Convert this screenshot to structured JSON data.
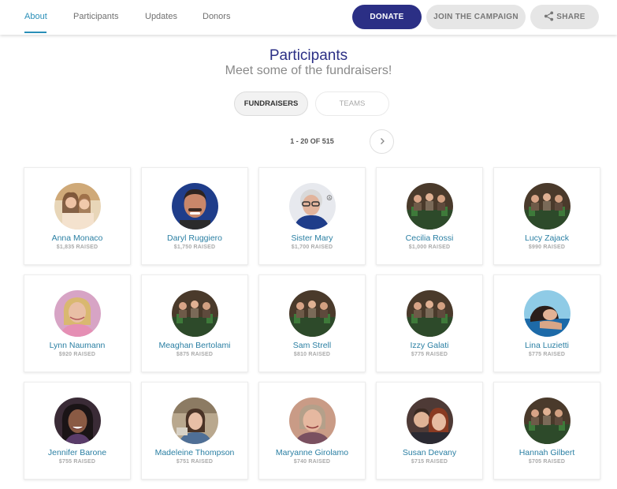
{
  "nav": {
    "tabs": [
      {
        "label": "About",
        "active": true
      },
      {
        "label": "Participants",
        "active": false
      },
      {
        "label": "Updates",
        "active": false
      },
      {
        "label": "Donors",
        "active": false
      }
    ],
    "donate_label": "DONATE",
    "join_label": "JOIN THE CAMPAIGN",
    "share_label": "SHARE"
  },
  "header": {
    "title": "Participants",
    "subtitle": "Meet some of the fundraisers!"
  },
  "filters": {
    "fundraisers_label": "FUNDRAISERS",
    "teams_label": "TEAMS",
    "active": "FUNDRAISERS"
  },
  "pagination": {
    "range_text": "1 - 20 OF 515"
  },
  "colors": {
    "brand": "#2b2f85",
    "link": "#2a8fb8"
  },
  "participants": [
    {
      "name": "Anna Monaco",
      "raised": "$1,835 RAISED"
    },
    {
      "name": "Daryl Ruggiero",
      "raised": "$1,750 RAISED"
    },
    {
      "name": "Sister Mary",
      "raised": "$1,700 RAISED"
    },
    {
      "name": "Cecilia Rossi",
      "raised": "$1,000 RAISED"
    },
    {
      "name": "Lucy Zajack",
      "raised": "$990 RAISED"
    },
    {
      "name": "Lynn Naumann",
      "raised": "$920 RAISED"
    },
    {
      "name": "Meaghan Bertolami",
      "raised": "$875 RAISED"
    },
    {
      "name": "Sam Strell",
      "raised": "$810 RAISED"
    },
    {
      "name": "Izzy Galati",
      "raised": "$775 RAISED"
    },
    {
      "name": "Lina Luzietti",
      "raised": "$775 RAISED"
    },
    {
      "name": "Jennifer Barone",
      "raised": "$755 RAISED"
    },
    {
      "name": "Madeleine Thompson",
      "raised": "$751 RAISED"
    },
    {
      "name": "Maryanne Girolamo",
      "raised": "$740 RAISED"
    },
    {
      "name": "Susan Devany",
      "raised": "$715 RAISED"
    },
    {
      "name": "Hannah Gilbert",
      "raised": "$705 RAISED"
    }
  ]
}
